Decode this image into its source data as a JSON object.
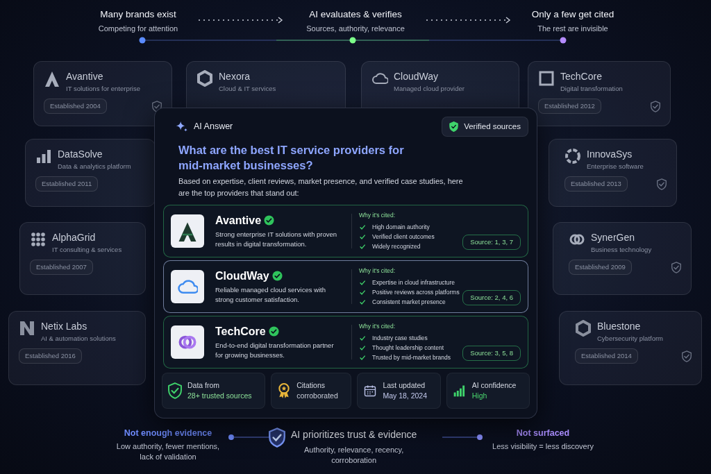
{
  "flow": {
    "steps": [
      {
        "title": "Many brands exist",
        "subtitle": "Competing for attention",
        "color": "#5b8cff"
      },
      {
        "title": "AI evaluates & verifies",
        "subtitle": "Sources, authority, relevance",
        "color": "#7dff8a"
      },
      {
        "title": "Only a few get cited",
        "subtitle": "The rest are invisible",
        "color": "#b58cff"
      }
    ]
  },
  "brands": [
    {
      "name": "Avantive",
      "tagline": "IT solutions for enterprise",
      "established": "Established 2004",
      "shield": true
    },
    {
      "name": "Nexora",
      "tagline": "Cloud & IT services",
      "shield": false
    },
    {
      "name": "CloudWay",
      "tagline": "Managed cloud provider",
      "shield": false
    },
    {
      "name": "TechCore",
      "tagline": "Digital transformation",
      "established": "Established 2012",
      "shield": true
    },
    {
      "name": "DataSolve",
      "tagline": "Data & analytics platform",
      "established": "Established 2011",
      "shield": false
    },
    {
      "name": "AlphaGrid",
      "tagline": "IT consulting & services",
      "established": "Established 2007",
      "shield": false
    },
    {
      "name": "Netix Labs",
      "tagline": "AI & automation solutions",
      "established": "Established 2016",
      "shield": false
    },
    {
      "name": "InnovaSys",
      "tagline": "Enterprise software",
      "established": "Established 2013",
      "shield": true
    },
    {
      "name": "SynerGen",
      "tagline": "Business technology",
      "established": "Established 2009",
      "shield": true
    },
    {
      "name": "Bluestone",
      "tagline": "Cybersecurity platform",
      "established": "Established 2014",
      "shield": true
    }
  ],
  "answer": {
    "label": "AI Answer",
    "badge": "Verified sources",
    "question": "What are the best IT service providers for mid-market businesses?",
    "intro": "Based on expertise, client reviews, market presence, and verified case studies, here are the top providers that stand out:",
    "providers": [
      {
        "name": "Avantive",
        "description": "Strong enterprise IT solutions with proven results in digital transformation.",
        "why_label": "Why it's cited:",
        "reasons": [
          "High domain authority",
          "Verified client outcomes",
          "Widely recognized"
        ],
        "source": "Source: 1, 3, 7",
        "highlighted": false
      },
      {
        "name": "CloudWay",
        "description": "Reliable managed cloud services with strong customer satisfaction.",
        "why_label": "Why it's cited:",
        "reasons": [
          "Expertise in cloud infrastructure",
          "Positive reviews across platforms",
          "Consistent market presence"
        ],
        "source": "Source: 2, 4, 6",
        "highlighted": true
      },
      {
        "name": "TechCore",
        "description": "End-to-end digital transformation partner for growing businesses.",
        "why_label": "Why it's cited:",
        "reasons": [
          "Industry case studies",
          "Thought leadership content",
          "Trusted by mid-market brands"
        ],
        "source": "Source: 3, 5, 8",
        "highlighted": false
      }
    ],
    "stats": [
      {
        "kind": "sources",
        "label": "Data from",
        "value": "28+ trusted sources"
      },
      {
        "kind": "citations",
        "label": "Citations",
        "value": "corroborated"
      },
      {
        "kind": "date",
        "label": "Last updated",
        "value": "May 18, 2024"
      },
      {
        "kind": "confidence",
        "label": "AI confidence",
        "value": "High"
      }
    ]
  },
  "footer": {
    "left": {
      "title": "Not enough evidence",
      "text": "Low authority, fewer mentions, lack of validation",
      "color": "#6f8cff"
    },
    "center": {
      "title": "AI prioritizes trust & evidence",
      "text": "Authority, relevance, recency, corroboration"
    },
    "right": {
      "title": "Not surfaced",
      "text": "Less visibility = less discovery",
      "color": "#a78bfa"
    }
  }
}
